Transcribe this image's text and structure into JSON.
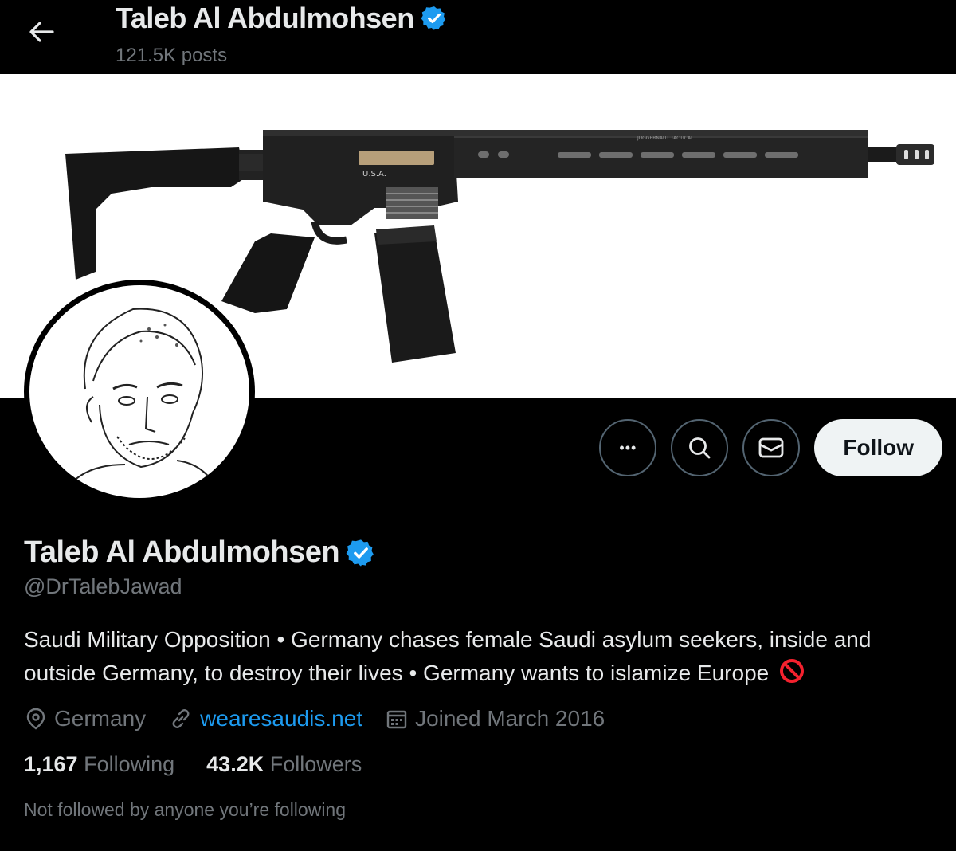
{
  "header": {
    "title": "Taleb Al Abdulmohsen",
    "posts": "121.5K posts"
  },
  "banner": {
    "engraving_left": "U.S.A.",
    "engraving_top": "JUGGERNAUT TACTICAL"
  },
  "actions": {
    "more_glyph": "•••",
    "follow_label": "Follow"
  },
  "profile": {
    "name": "Taleb Al Abdulmohsen",
    "handle": "@DrTalebJawad",
    "bio": "Saudi Military Opposition • Germany chases female Saudi asylum seekers, inside and outside Germany, to destroy their lives • Germany wants to islamize Europe",
    "location": "Germany",
    "website": "wearesaudis.net",
    "joined": "Joined March 2016",
    "following_count": "1,167",
    "following_label": "Following",
    "followers_count": "43.2K",
    "followers_label": "Followers",
    "not_followed": "Not followed by anyone you’re following"
  },
  "colors": {
    "accent": "#1d9bf0",
    "verified": "#1d9bf0",
    "muted": "#71767b",
    "text": "#e7e9ea",
    "no_entry": "#f4212e"
  },
  "icons": [
    "back-arrow-icon",
    "verified-badge-icon",
    "more-icon",
    "search-icon",
    "message-icon",
    "location-pin-icon",
    "link-icon",
    "calendar-icon",
    "no-entry-icon"
  ]
}
